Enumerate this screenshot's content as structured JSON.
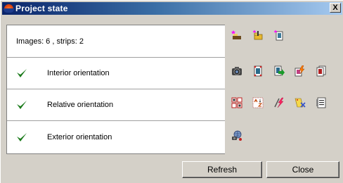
{
  "window": {
    "title": "Project state",
    "close_glyph": "X"
  },
  "summary": {
    "text": "Images: 6 , strips: 2"
  },
  "steps": [
    {
      "label": "Interior orientation",
      "status": "done",
      "status_icon": "checkmark-icon"
    },
    {
      "label": "Relative orientation",
      "status": "done",
      "status_icon": "checkmark-icon"
    },
    {
      "label": "Exterior orientation",
      "status": "done",
      "status_icon": "checkmark-icon"
    }
  ],
  "toolbar": {
    "row_1": [
      "new-images-icon",
      "add-folder-icon",
      "add-image-icon"
    ],
    "row_2": [
      "camera-icon",
      "interior-points-icon",
      "export-orientation-icon",
      "auto-measure-icon",
      "orientation-report-icon"
    ],
    "row_3": [
      "tie-points-icon",
      "sort-points-icon",
      "quick-adjust-icon",
      "clear-points-icon",
      "relative-report-icon"
    ],
    "row_4": [
      "exterior-solve-icon"
    ]
  },
  "buttons": {
    "refresh": "Refresh",
    "close": "Close"
  },
  "colors": {
    "check": "#1a7a1a",
    "title_start": "#0a246a",
    "title_end": "#a6caf0",
    "face": "#d4d0c8"
  }
}
